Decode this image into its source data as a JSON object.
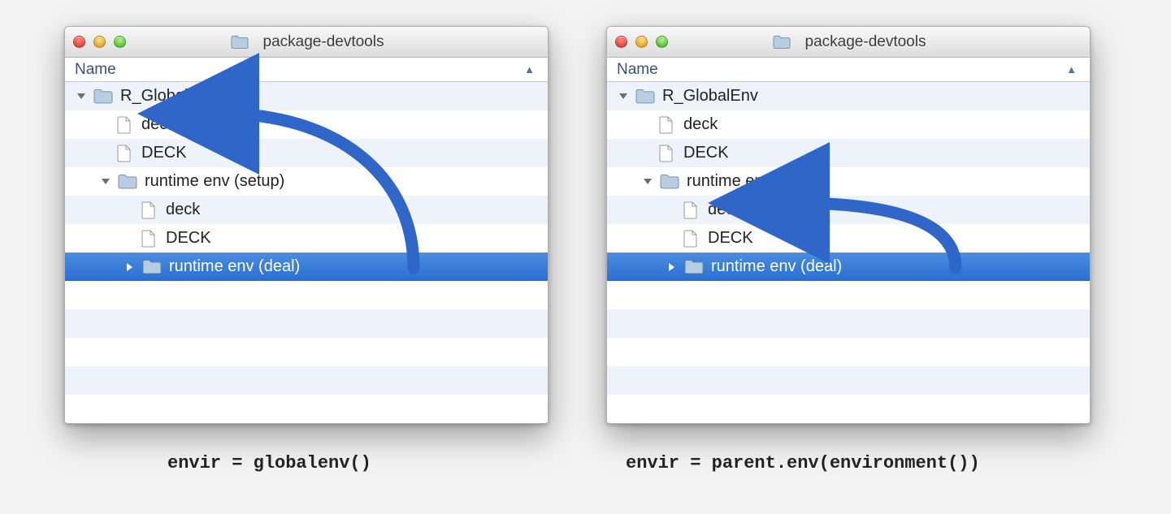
{
  "windows": {
    "left": {
      "title": "package-devtools",
      "header": "Name",
      "rows": {
        "r_global": "R_GlobalEnv",
        "deck_lc": "deck",
        "deck_uc": "DECK",
        "runtime_setup": "runtime env (setup)",
        "deck_lc2": "deck",
        "deck_uc2": "DECK",
        "runtime_deal": "runtime env (deal)"
      }
    },
    "right": {
      "title": "package-devtools",
      "header": "Name",
      "rows": {
        "r_global": "R_GlobalEnv",
        "deck_lc": "deck",
        "deck_uc": "DECK",
        "runtime_setup": "runtime env (setup)",
        "deck_lc2": "deck",
        "deck_uc2": "DECK",
        "runtime_deal": "runtime env (deal)"
      }
    }
  },
  "captions": {
    "left": "envir = globalenv()",
    "right": "envir = parent.env(environment())"
  },
  "icons": {
    "close": "close-icon",
    "min": "minimize-icon",
    "zoom": "zoom-icon",
    "folder": "folder-icon",
    "file": "file-icon",
    "chevron_down": "chevron-down-icon",
    "chevron_right": "chevron-right-icon",
    "sort_asc": "sort-ascending-icon"
  },
  "colors": {
    "selection": "#2f74d4",
    "arrow": "#2f66c8",
    "alt_row": "#eef3fb"
  }
}
